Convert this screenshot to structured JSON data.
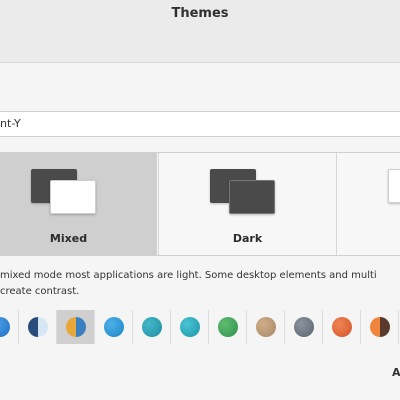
{
  "window": {
    "title": "Themes"
  },
  "theme_field": {
    "value": "int-Y"
  },
  "modes": [
    {
      "label": "Mixed",
      "selected": true
    },
    {
      "label": "Dark",
      "selected": false
    },
    {
      "label": "",
      "selected": false
    }
  ],
  "description": {
    "line1": "mixed mode most applications are light. Some desktop elements and multi",
    "line2": "create contrast."
  },
  "accents": [
    {
      "name": "blue",
      "colors": [
        "#1f6fc4",
        "#4aa0e6"
      ],
      "split": false,
      "selected": false
    },
    {
      "name": "navy-light",
      "colors": [
        "#2a4c7d",
        "#d7e6f4"
      ],
      "split": true,
      "selected": false
    },
    {
      "name": "blue-orange",
      "colors": [
        "#e8a73a",
        "#3a7fbf"
      ],
      "split": true,
      "selected": true
    },
    {
      "name": "aqua-blue",
      "colors": [
        "#1d86c8",
        "#4cb0e8"
      ],
      "split": false,
      "selected": false
    },
    {
      "name": "teal",
      "colors": [
        "#1c8ea0",
        "#45b8c8"
      ],
      "split": false,
      "selected": false
    },
    {
      "name": "cyan",
      "colors": [
        "#1796a8",
        "#4cc3d4"
      ],
      "split": false,
      "selected": false
    },
    {
      "name": "green",
      "colors": [
        "#2f8f4a",
        "#5fbd72"
      ],
      "split": false,
      "selected": false
    },
    {
      "name": "sand",
      "colors": [
        "#a98765",
        "#cfae8a"
      ],
      "split": false,
      "selected": false
    },
    {
      "name": "grey",
      "colors": [
        "#5c6470",
        "#8a929c"
      ],
      "split": false,
      "selected": false
    },
    {
      "name": "orange",
      "colors": [
        "#d2552a",
        "#f08452"
      ],
      "split": false,
      "selected": false
    },
    {
      "name": "orange-dark",
      "colors": [
        "#f0843a",
        "#5a3a2a"
      ],
      "split": true,
      "selected": false
    }
  ],
  "bottom": {
    "label": "A"
  }
}
